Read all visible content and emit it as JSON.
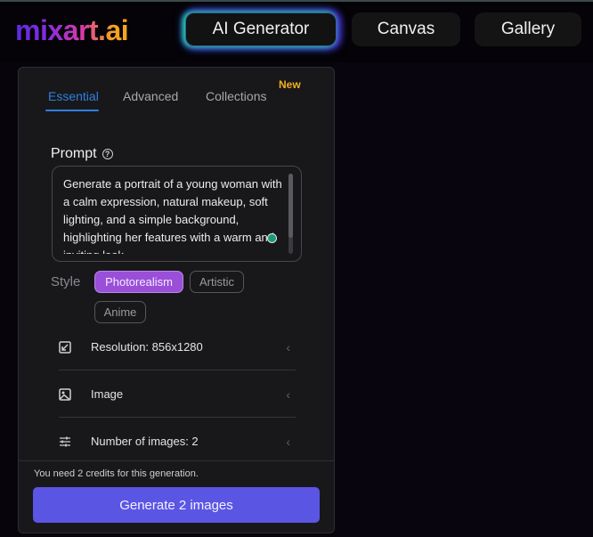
{
  "header": {
    "logo": "mixart.ai",
    "nav": [
      {
        "label": "AI Generator",
        "active": true
      },
      {
        "label": "Canvas",
        "active": false
      },
      {
        "label": "Gallery",
        "active": false
      }
    ]
  },
  "panel": {
    "tabs": [
      {
        "label": "Essential",
        "active": true
      },
      {
        "label": "Advanced",
        "active": false
      },
      {
        "label": "Collections",
        "active": false,
        "badge": "New"
      }
    ],
    "prompt": {
      "label": "Prompt",
      "help_icon": "?",
      "value": "Generate a portrait of a young woman with a calm expression, natural makeup, soft lighting, and a simple background, highlighting her features with a warm and inviting look."
    },
    "style": {
      "label": "Style",
      "options": [
        {
          "label": "Photorealism",
          "selected": true
        },
        {
          "label": "Artistic",
          "selected": false
        },
        {
          "label": "Anime",
          "selected": false
        }
      ]
    },
    "options": [
      {
        "icon": "resize-icon",
        "label": "Resolution: 856x1280",
        "chevron": "‹"
      },
      {
        "icon": "image-icon",
        "label": "Image",
        "chevron": "‹"
      },
      {
        "icon": "sliders-icon",
        "label": "Number of images: 2",
        "chevron": "‹"
      }
    ],
    "footer": {
      "credits_note": "You need 2 credits for this generation.",
      "generate_label": "Generate 2 images"
    }
  },
  "colors": {
    "accent_tab": "#2f7fe0",
    "chip_selected": "#9a4fd8",
    "generate_button": "#5b55e4",
    "badge_new": "#f0b020"
  }
}
